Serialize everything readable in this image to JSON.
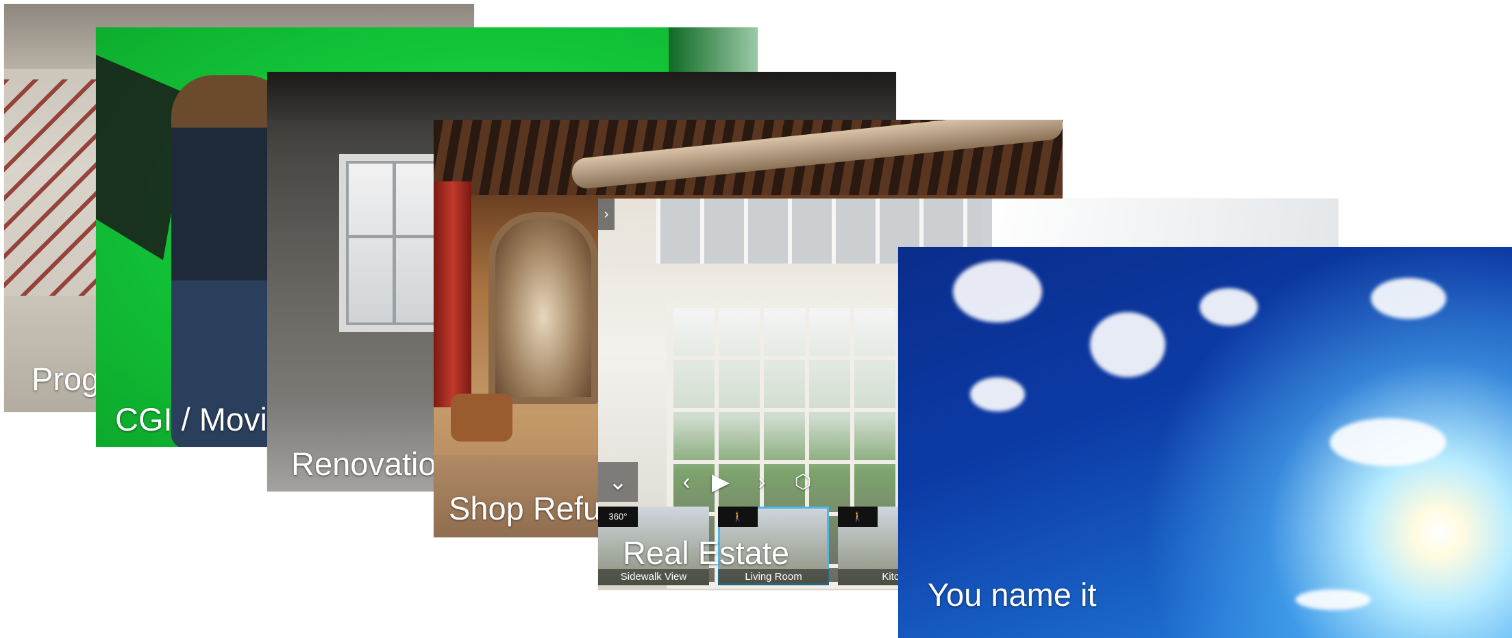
{
  "cards": [
    {
      "caption": "Prog"
    },
    {
      "caption": "CGI / Movi"
    },
    {
      "caption": "Renovatio"
    },
    {
      "caption": "Shop Refu"
    },
    {
      "caption": "Real Estate"
    },
    {
      "caption": "You name it"
    }
  ],
  "tour": {
    "thumbnails": [
      {
        "badge": "360°",
        "label": "Sidewalk View"
      },
      {
        "badge": "🚶",
        "label": "Living Room"
      },
      {
        "badge": "🚶",
        "label": "Kitch"
      }
    ]
  }
}
